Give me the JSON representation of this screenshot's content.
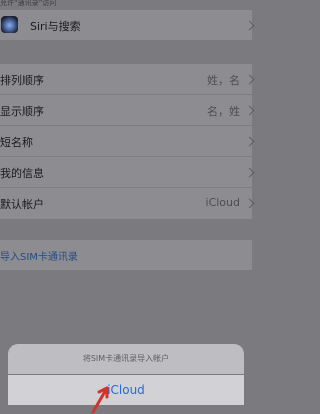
{
  "header": {
    "caption": "允许“通讯录”访问"
  },
  "siri_row": {
    "label": "Siri与搜索"
  },
  "settings": [
    {
      "label": "排列顺序",
      "value": "姓，名"
    },
    {
      "label": "显示顺序",
      "value": "名，姓"
    },
    {
      "label": "短名称",
      "value": ""
    },
    {
      "label": "我的信息",
      "value": ""
    },
    {
      "label": "默认帐户",
      "value": "iCloud"
    }
  ],
  "import": {
    "label": "导入SIM卡通讯录"
  },
  "action_sheet": {
    "title": "将SIM卡通讯录导入帐户",
    "option": "iCloud"
  },
  "colors": {
    "accent_blue": "#2a69d4",
    "arrow_red": "#d0342c",
    "dim_background": "#7b7b7f"
  }
}
